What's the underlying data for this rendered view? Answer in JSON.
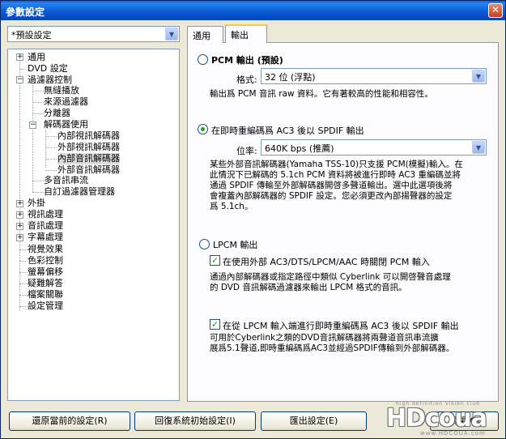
{
  "window": {
    "title": "參數設定",
    "close_glyph": "✕"
  },
  "profile": {
    "value": "*預設設定",
    "dropdown_glyph": "▼"
  },
  "tree": {
    "expand_glyph": "+",
    "collapse_glyph": "−",
    "items": [
      {
        "label": "通用"
      },
      {
        "label": "DVD 設定"
      },
      {
        "label": "過濾器控制"
      },
      {
        "label": "無縫播放"
      },
      {
        "label": "來源過濾器"
      },
      {
        "label": "分離器"
      },
      {
        "label": "解碼器使用"
      },
      {
        "label": "內部視訊解碼器"
      },
      {
        "label": "外部視訊解碼器"
      },
      {
        "label": "內部音訊解碼器"
      },
      {
        "label": "外部音訊解碼器"
      },
      {
        "label": "多音訊串流"
      },
      {
        "label": "自訂過濾器管理器"
      },
      {
        "label": "外掛"
      },
      {
        "label": "視訊處理"
      },
      {
        "label": "音訊處理"
      },
      {
        "label": "字幕處理"
      },
      {
        "label": "視覺效果"
      },
      {
        "label": "色彩控制"
      },
      {
        "label": "螢幕偏移"
      },
      {
        "label": "疑難解答"
      },
      {
        "label": "檔案關聯"
      },
      {
        "label": "設定管理"
      }
    ]
  },
  "tabs": [
    {
      "label": "通用"
    },
    {
      "label": "輸出"
    }
  ],
  "output": {
    "pcm": {
      "label": "PCM 輸出 (預設)",
      "format_label": "格式:",
      "format_value": "32 位 (浮點)",
      "desc": "輸出爲 PCM 音訊 raw 資料。它有著較高的性能和相容性。"
    },
    "ac3": {
      "label": "在即時重編碼爲 AC3 後以 SPDIF 輸出",
      "bitrate_label": "位率:",
      "bitrate_value": "640K bps (推薦)",
      "desc": "某些外部音訊解碼器(Yamaha TSS-10)只支援 PCM(模擬)輸入。在\n此情況下已解碼的 5.1ch PCM 資料將被進行即時 AC3 重編碼並將\n通過 SPDIF 傳輸至外部解碼器開啓多聲道輸出。選中此選項後將\n會複蓋內部解碼器的 SPDIF 設定。您必須更改內部揚聲器的設定\n爲 5.1ch。"
    },
    "lpcm": {
      "label": "LPCM 輸出",
      "check1_label": "在使用外部 AC3/DTS/LPCM/AAC 時關閉 PCM 輸入",
      "check1_desc": "通過內部解碼器或指定路徑中類似 Cyberlink 可以開啓聲音處理\n的 DVD 音訊解碼過濾器來輸出 LPCM 格式的音訊。",
      "check2_label": "在從 LPCM 輸入端進行即時重編碼爲 AC3 後以 SPDIF 輸出",
      "check2_desc": "可用於Cyberlink之類的DVD音訊解碼器將兩聲道音訊串流擴\n展爲5.1聲道,即時重編碼爲AC3並經過SPDIF傳輸到外部解碼器。"
    },
    "check_glyph": "✓"
  },
  "buttons": {
    "restore": "還原當前的設定(R)",
    "reset": "回復系統初始設定(I)",
    "export": "匯出設定(E)",
    "close": "關閉(C)"
  },
  "watermark": {
    "brand": "HDcoua",
    "tagline": "high definition vision club",
    "url": "www.HDCOUA.com"
  }
}
